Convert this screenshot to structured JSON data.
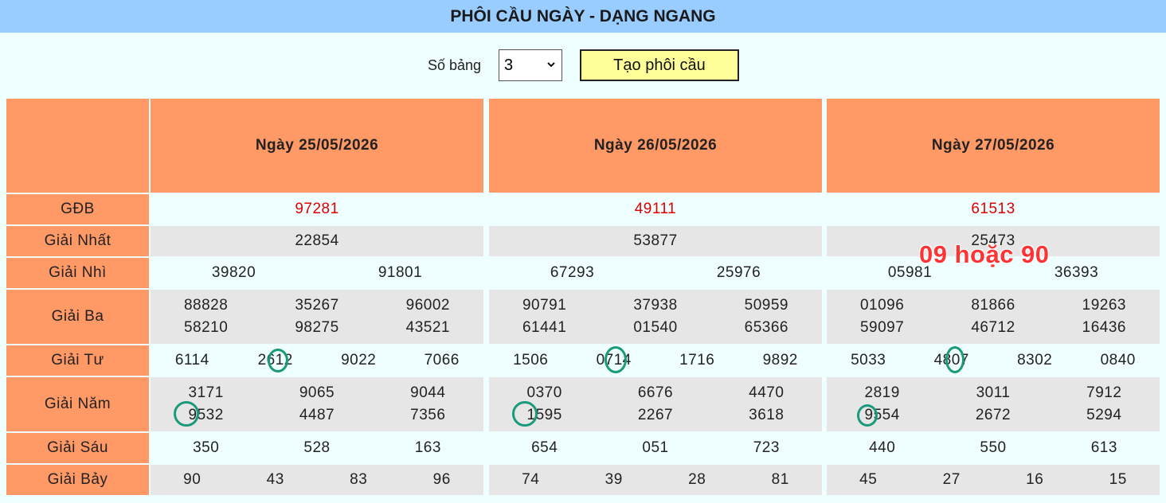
{
  "header": {
    "title": "PHÔI CẦU NGÀY - DẠNG NGANG"
  },
  "controls": {
    "label": "Số bảng",
    "selected_value": "3",
    "button_label": "Tạo phôi cầu"
  },
  "table": {
    "dates": [
      "Ngày 25/05/2026",
      "Ngày 26/05/2026",
      "Ngày 27/05/2026"
    ],
    "rows": [
      {
        "label": "GĐB",
        "values": [
          [
            "97281"
          ],
          [
            "49111"
          ],
          [
            "61513"
          ]
        ]
      },
      {
        "label": "Giải Nhất",
        "values": [
          [
            "22854"
          ],
          [
            "53877"
          ],
          [
            "25473"
          ]
        ]
      },
      {
        "label": "Giải Nhì",
        "values": [
          [
            "39820",
            "91801"
          ],
          [
            "67293",
            "25976"
          ],
          [
            "05981",
            "36393"
          ]
        ]
      },
      {
        "label": "Giải Ba",
        "values": [
          [
            "88828",
            "35267",
            "96002",
            "58210",
            "98275",
            "43521"
          ],
          [
            "90791",
            "37938",
            "50959",
            "61441",
            "01540",
            "65366"
          ],
          [
            "01096",
            "81866",
            "19263",
            "59097",
            "46712",
            "16436"
          ]
        ]
      },
      {
        "label": "Giải Tư",
        "values": [
          [
            "6114",
            "2612",
            "9022",
            "7066"
          ],
          [
            "1506",
            "0714",
            "1716",
            "9892"
          ],
          [
            "5033",
            "4807",
            "8302",
            "0840"
          ]
        ]
      },
      {
        "label": "Giải Năm",
        "values": [
          [
            "3171",
            "9065",
            "9044",
            "9532",
            "4487",
            "7356"
          ],
          [
            "0370",
            "6676",
            "4470",
            "1595",
            "2267",
            "3618"
          ],
          [
            "2819",
            "3011",
            "7912",
            "9554",
            "2672",
            "5294"
          ]
        ]
      },
      {
        "label": "Giải Sáu",
        "values": [
          [
            "350",
            "528",
            "163"
          ],
          [
            "654",
            "051",
            "723"
          ],
          [
            "440",
            "550",
            "613"
          ]
        ]
      },
      {
        "label": "Giải Bảy",
        "values": [
          [
            "90",
            "43",
            "83",
            "96"
          ],
          [
            "74",
            "39",
            "28",
            "81"
          ],
          [
            "45",
            "27",
            "16",
            "15"
          ]
        ]
      }
    ]
  },
  "prediction": {
    "text": "09 hoặc 90"
  },
  "colors": {
    "title_bar": "#99ccff",
    "label_bg": "#ff9966",
    "special_prize": "#e00000",
    "highlight_ring": "#1a9a7a",
    "prediction_text": "#ff3333"
  }
}
